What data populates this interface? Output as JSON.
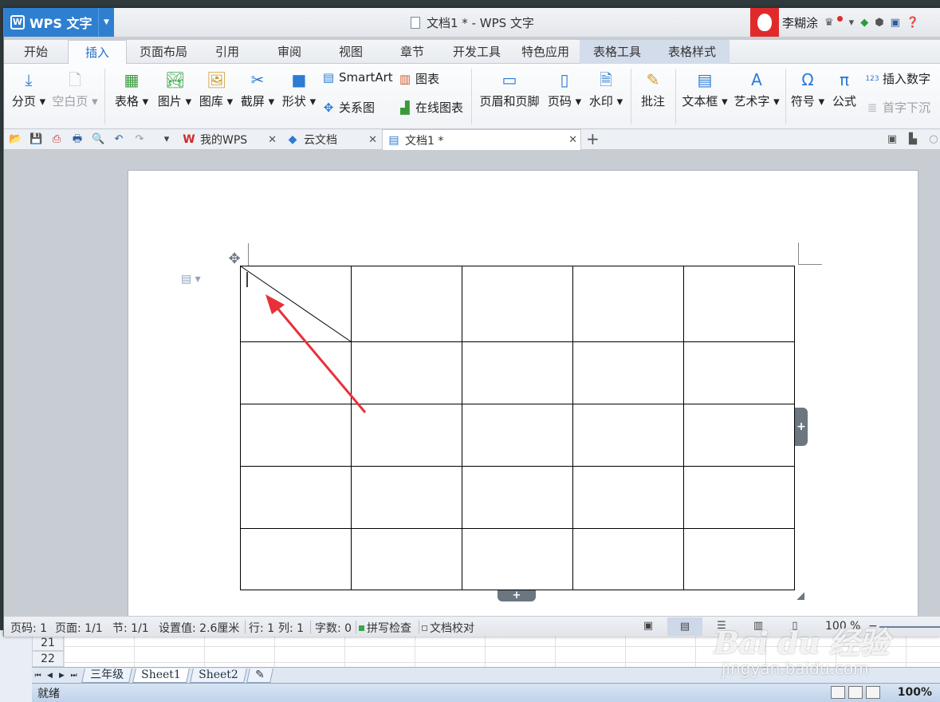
{
  "app": {
    "name": "WPS 文字",
    "logo": "W"
  },
  "window_title": "文档1 * - WPS 文字",
  "user": {
    "name": "李糊涂"
  },
  "ribbon_tabs": [
    "开始",
    "插入",
    "页面布局",
    "引用",
    "审阅",
    "视图",
    "章节",
    "开发工具",
    "特色应用",
    "表格工具",
    "表格样式"
  ],
  "active_tab": "插入",
  "toolbar": {
    "page_break": "分页",
    "blank_page": "空白页",
    "table": "表格",
    "picture": "图片",
    "gallery": "图库",
    "screenshot": "截屏",
    "shapes": "形状",
    "smartart": "SmartArt",
    "chart": "图表",
    "relation_chart": "关系图",
    "online_chart": "在线图表",
    "header_footer": "页眉和页脚",
    "page_number": "页码",
    "watermark": "水印",
    "comment": "批注",
    "textbox": "文本框",
    "wordart": "艺术字",
    "symbol": "符号",
    "formula": "公式",
    "insert_number": "插入数字",
    "drop_cap": "首字下沉"
  },
  "doc_tabs": [
    {
      "label": "我的WPS"
    },
    {
      "label": "云文档"
    },
    {
      "label": "文档1 *"
    }
  ],
  "table": {
    "rows": 5,
    "cols": 5
  },
  "status": {
    "page_no": "页码: 1",
    "pages": "页面: 1/1",
    "section": "节: 1/1",
    "setting": "设置值: 2.6厘米",
    "row": "行: 1",
    "col": "列: 1",
    "word_count": "字数: 0",
    "spell_check": "拼写检查",
    "doc_proof": "文档校对",
    "zoom": "100 %"
  },
  "excel": {
    "row_numbers": [
      "21",
      "22"
    ],
    "sheet_tabs": [
      "三年级",
      "Sheet1",
      "Sheet2"
    ],
    "status_ready": "就绪",
    "zoom": "100%"
  },
  "watermark": {
    "main": "Bai du 经验",
    "sub": "jingyan.baidu.com"
  },
  "colors": {
    "accent": "#2f7fd0",
    "arrow": "#e8303a",
    "check": "#3aa648"
  }
}
